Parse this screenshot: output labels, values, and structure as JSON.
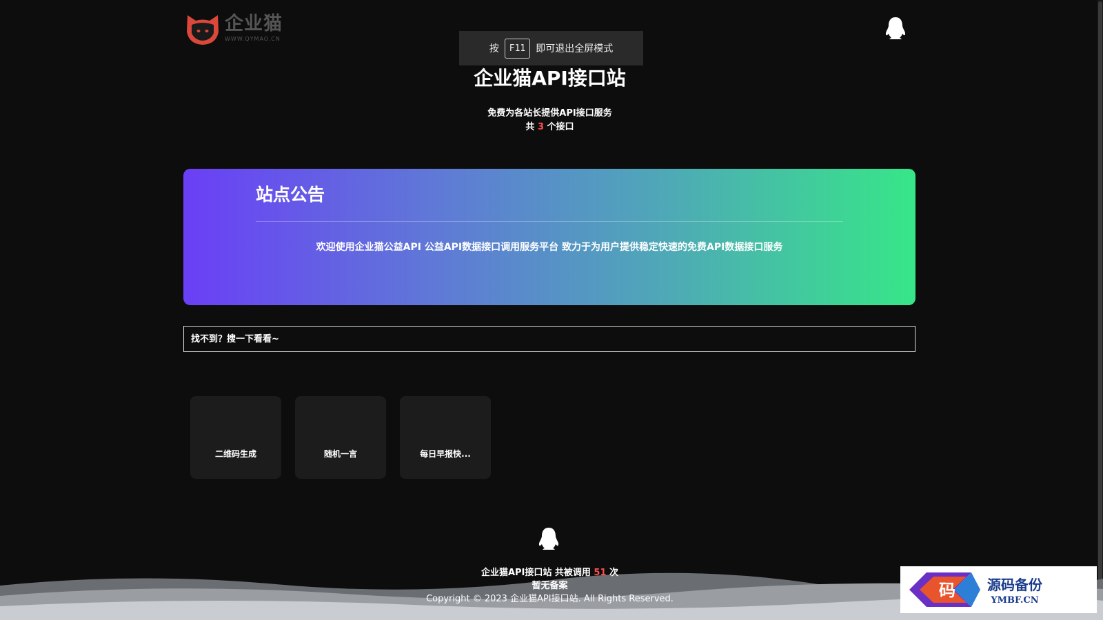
{
  "header": {
    "logo_name": "企业猫",
    "logo_url": "WWW.QYMAO.CN",
    "qq_icon": "qq-penguin-icon"
  },
  "fullscreen_toast": {
    "prefix": "按",
    "key": "F11",
    "suffix": "即可退出全屏模式"
  },
  "hero": {
    "title": "企业猫API接口站",
    "subtitle": "免费为各站长提供API接口服务",
    "count_prefix": "共",
    "count_value": "3",
    "count_suffix": "个接口"
  },
  "notice": {
    "title": "站点公告",
    "body": "欢迎使用企业猫公益API 公益API数据接口调用服务平台 致力于为用户提供稳定快速的免费API数据接口服务",
    "gradient": [
      "#6a3ff6",
      "#37e688"
    ]
  },
  "search": {
    "placeholder": "找不到？搜一下看看~"
  },
  "api_cards": [
    {
      "label": "二维码生成"
    },
    {
      "label": "随机一言"
    },
    {
      "label": "每日早报快..."
    }
  ],
  "footer": {
    "call_prefix": "企业猫API接口站 共被调用",
    "call_count": "51",
    "call_suffix": "次",
    "icp": "暂无备案",
    "copyright": "Copyright © 2023 企业猫API接口站. All Rights Reserved."
  },
  "watermark": {
    "name": "源码备份",
    "url": "YMBF.CN",
    "logo_char": "码"
  },
  "colors": {
    "background": "#0d0d0d",
    "accent_red": "#ff4d4f",
    "card_bg": "#1c1c1c"
  }
}
